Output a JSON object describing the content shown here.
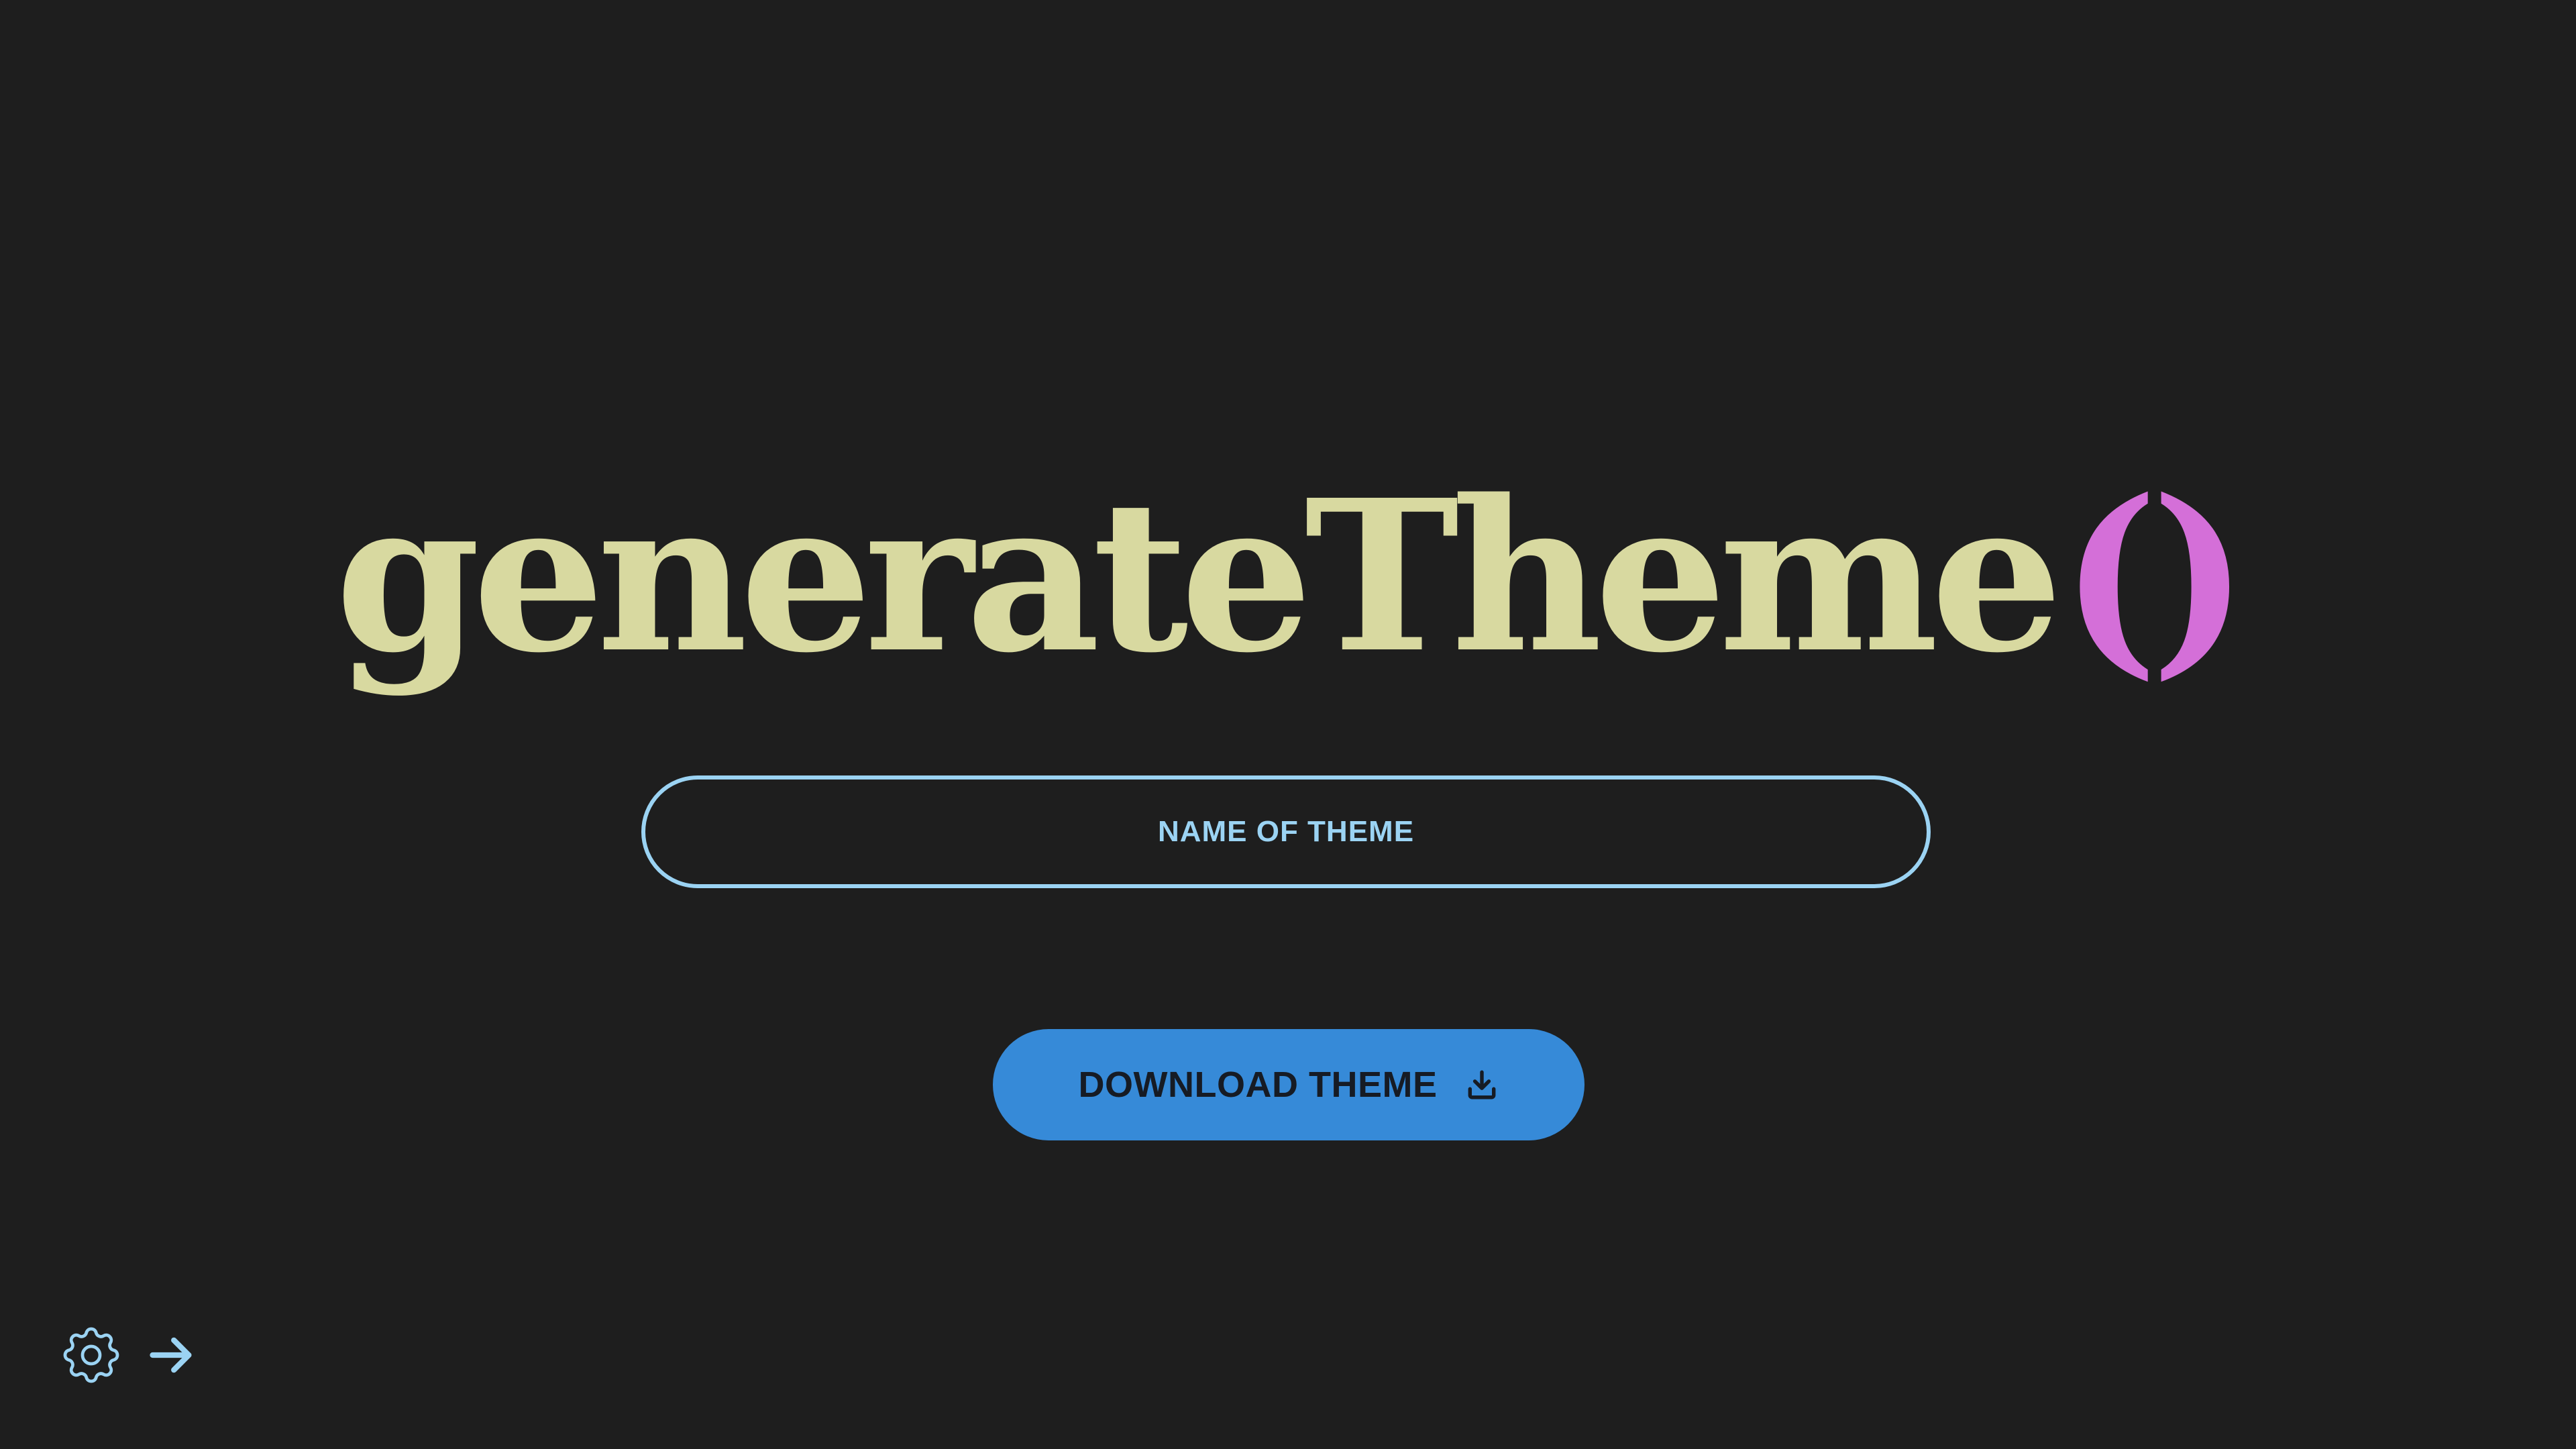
{
  "title": {
    "name": "generateTheme",
    "parens": "()"
  },
  "theme_name_input": {
    "placeholder": "NAME OF THEME",
    "value": ""
  },
  "download_button": {
    "label": "DOWNLOAD THEME",
    "icon": "download-icon"
  },
  "toolbar": {
    "settings_icon": "gear-icon",
    "next_icon": "arrow-right-icon"
  },
  "colors": {
    "background": "#1e1e1e",
    "title": "#d8d9a0",
    "parens": "#d46fd8",
    "accent_outline": "#9bd3f3",
    "button": "#368ad8",
    "button_text": "#161b24"
  }
}
